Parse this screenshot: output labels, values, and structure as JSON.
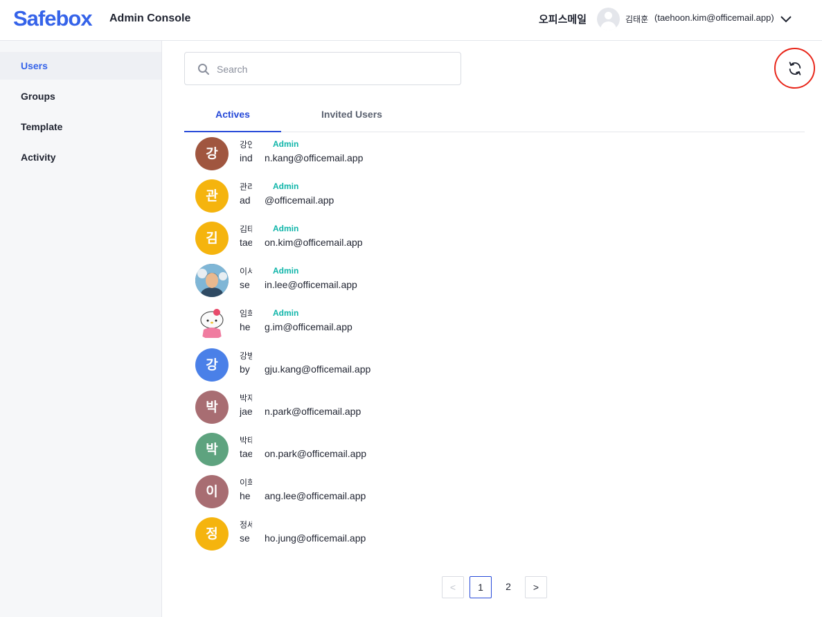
{
  "header": {
    "logo": "Safebox",
    "console_title": "Admin Console",
    "org_name": "오피스메일",
    "user_name": "김태훈",
    "user_email": "(taehoon.kim@officemail.app)"
  },
  "sidebar": {
    "items": [
      {
        "label": "Users"
      },
      {
        "label": "Groups"
      },
      {
        "label": "Template"
      },
      {
        "label": "Activity"
      }
    ]
  },
  "search": {
    "placeholder": "Search"
  },
  "tabs": [
    {
      "label": "Actives"
    },
    {
      "label": "Invited Users"
    }
  ],
  "users": [
    {
      "initial": "강",
      "name_visible": "강인",
      "email_left": "ind",
      "email_right": "n.kang@officemail.app",
      "badge": "Admin",
      "color": "#a0563f"
    },
    {
      "initial": "관",
      "name_visible": "관리",
      "email_left": "ad",
      "email_right": "@officemail.app",
      "badge": "Admin",
      "color": "#f5b40e"
    },
    {
      "initial": "김",
      "name_visible": "김태",
      "email_left": "tae",
      "email_right": "on.kim@officemail.app",
      "badge": "Admin",
      "color": "#f5b40e"
    },
    {
      "initial": "",
      "name_visible": "이서",
      "email_left": "se",
      "email_right": "in.lee@officemail.app",
      "badge": "Admin",
      "color": "#3f5e7a",
      "photo": "man"
    },
    {
      "initial": "",
      "name_visible": "임희",
      "email_left": "he",
      "email_right": "g.im@officemail.app",
      "badge": "Admin",
      "color": "#ffffff",
      "photo": "kitty"
    },
    {
      "initial": "강",
      "name_visible": "강병",
      "email_left": "by",
      "email_right": "gju.kang@officemail.app",
      "badge": "",
      "color": "#4a80e8"
    },
    {
      "initial": "박",
      "name_visible": "박재",
      "email_left": "jae",
      "email_right": "n.park@officemail.app",
      "badge": "",
      "color": "#a86d72"
    },
    {
      "initial": "박",
      "name_visible": "박태",
      "email_left": "tae",
      "email_right": "on.park@officemail.app",
      "badge": "",
      "color": "#5ea37f"
    },
    {
      "initial": "이",
      "name_visible": "이희",
      "email_left": "he",
      "email_right": "ang.lee@officemail.app",
      "badge": "",
      "color": "#a86d72"
    },
    {
      "initial": "정",
      "name_visible": "정세",
      "email_left": "se",
      "email_right": "ho.jung@officemail.app",
      "badge": "",
      "color": "#f5b40e"
    }
  ],
  "pagination": {
    "prev": "<",
    "pages": [
      "1",
      "2"
    ],
    "current": "1",
    "next": ">"
  },
  "colors": {
    "brand": "#3563e9",
    "active_tab": "#2649d8",
    "admin_badge": "#0fb5a9",
    "highlight_ring": "#e8261a"
  }
}
